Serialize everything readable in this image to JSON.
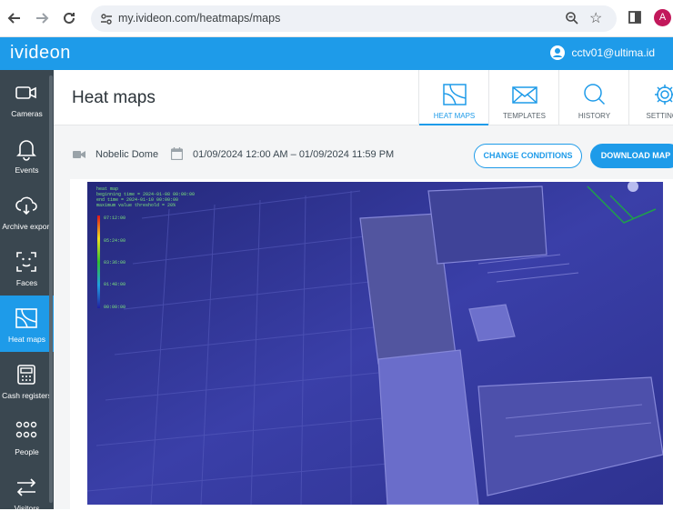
{
  "browser": {
    "url": "my.ividеon.com/heatmaps/maps",
    "profile_initial": "A"
  },
  "app": {
    "logo": "ivideon",
    "user_email": "cctv01@ultima.id"
  },
  "sidebar": {
    "items": [
      {
        "label": "Cameras",
        "icon": "camera-icon"
      },
      {
        "label": "Events",
        "icon": "bell-icon"
      },
      {
        "label": "Archive export",
        "icon": "cloud-download-icon"
      },
      {
        "label": "Faces",
        "icon": "face-scan-icon"
      },
      {
        "label": "Heat maps",
        "icon": "heatmap-icon",
        "active": true
      },
      {
        "label": "Cash registers",
        "icon": "cash-register-icon"
      },
      {
        "label": "People",
        "icon": "people-icon"
      },
      {
        "label": "Visitors",
        "icon": "arrows-icon"
      }
    ]
  },
  "page": {
    "title": "Heat maps",
    "tabs": [
      {
        "label": "HEAT MAPS",
        "icon": "heatmap-icon",
        "active": true
      },
      {
        "label": "TEMPLATES",
        "icon": "envelope-icon"
      },
      {
        "label": "HISTORY",
        "icon": "search-icon"
      },
      {
        "label": "SETTINGS",
        "icon": "gear-icon"
      }
    ]
  },
  "filter": {
    "camera_name": "Nobelic Dome",
    "date_range": "01/09/2024 12:00 AM – 01/09/2024 11:59 PM",
    "change_button": "CHANGE CONDITIONS",
    "download_button": "DOWNLOAD MAP"
  },
  "heatmap": {
    "overlay_lines": [
      "heat map",
      "beginning time = 2024-01-08 00:00:00",
      "end time = 2024-01-10 00:00:00",
      "maximum value threshold = 20%"
    ],
    "scale_labels": [
      "07:12:00",
      "05:24:00",
      "03:36:00",
      "01:48:00",
      "00:00:00"
    ],
    "colors": {
      "base": "#2c2f9e",
      "accent": "#1e9be9"
    }
  }
}
